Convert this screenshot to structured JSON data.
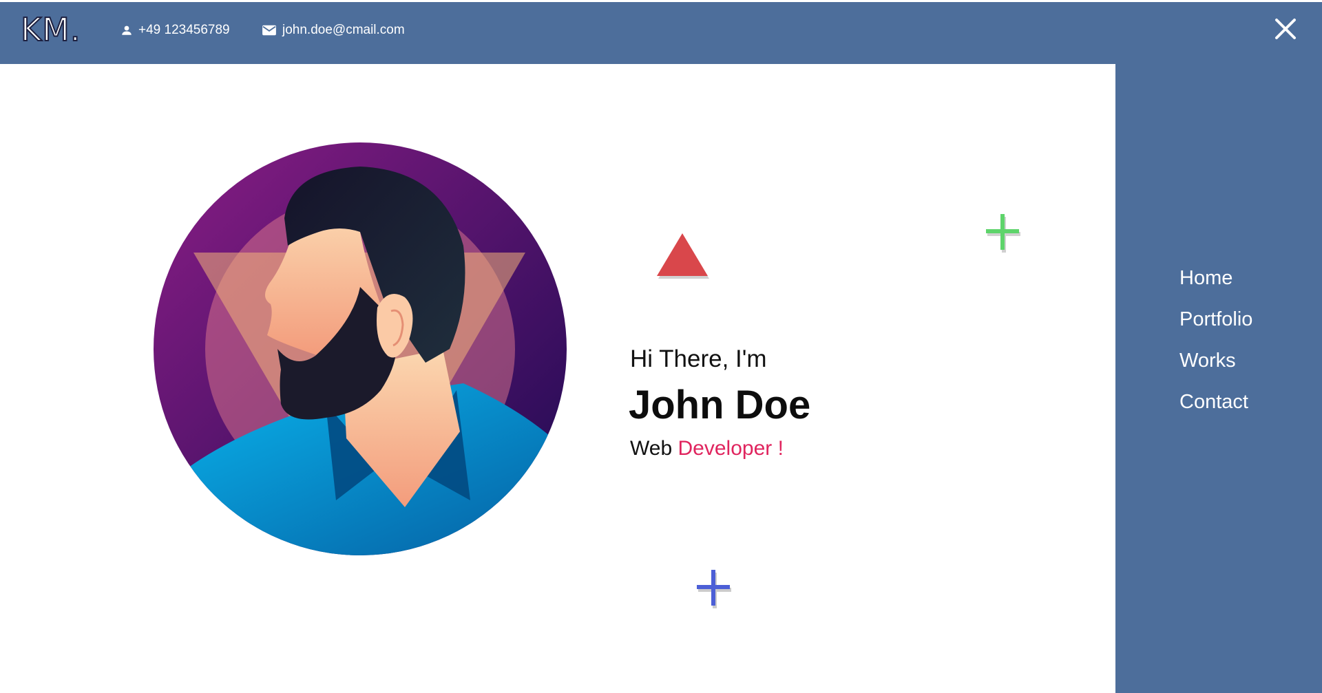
{
  "header": {
    "logo": "KM.",
    "phone": "+49 123456789",
    "email": "john.doe@cmail.com",
    "phone_icon": "person-icon",
    "email_icon": "mail-icon",
    "close_icon": "close-icon"
  },
  "menu": {
    "items": [
      {
        "label": "Home"
      },
      {
        "label": "Portfolio"
      },
      {
        "label": "Works"
      },
      {
        "label": "Contact"
      }
    ]
  },
  "hero": {
    "greeting": "Hi There, I'm",
    "name": "John Doe",
    "role_prefix": "Web",
    "role_highlight": "Developer !"
  },
  "colors": {
    "brand": "#4d6e9b",
    "accent": "#e0245e",
    "triangle": "#d9474b",
    "plus_green": "#5ed46b",
    "plus_blue": "#4c5fd6"
  }
}
